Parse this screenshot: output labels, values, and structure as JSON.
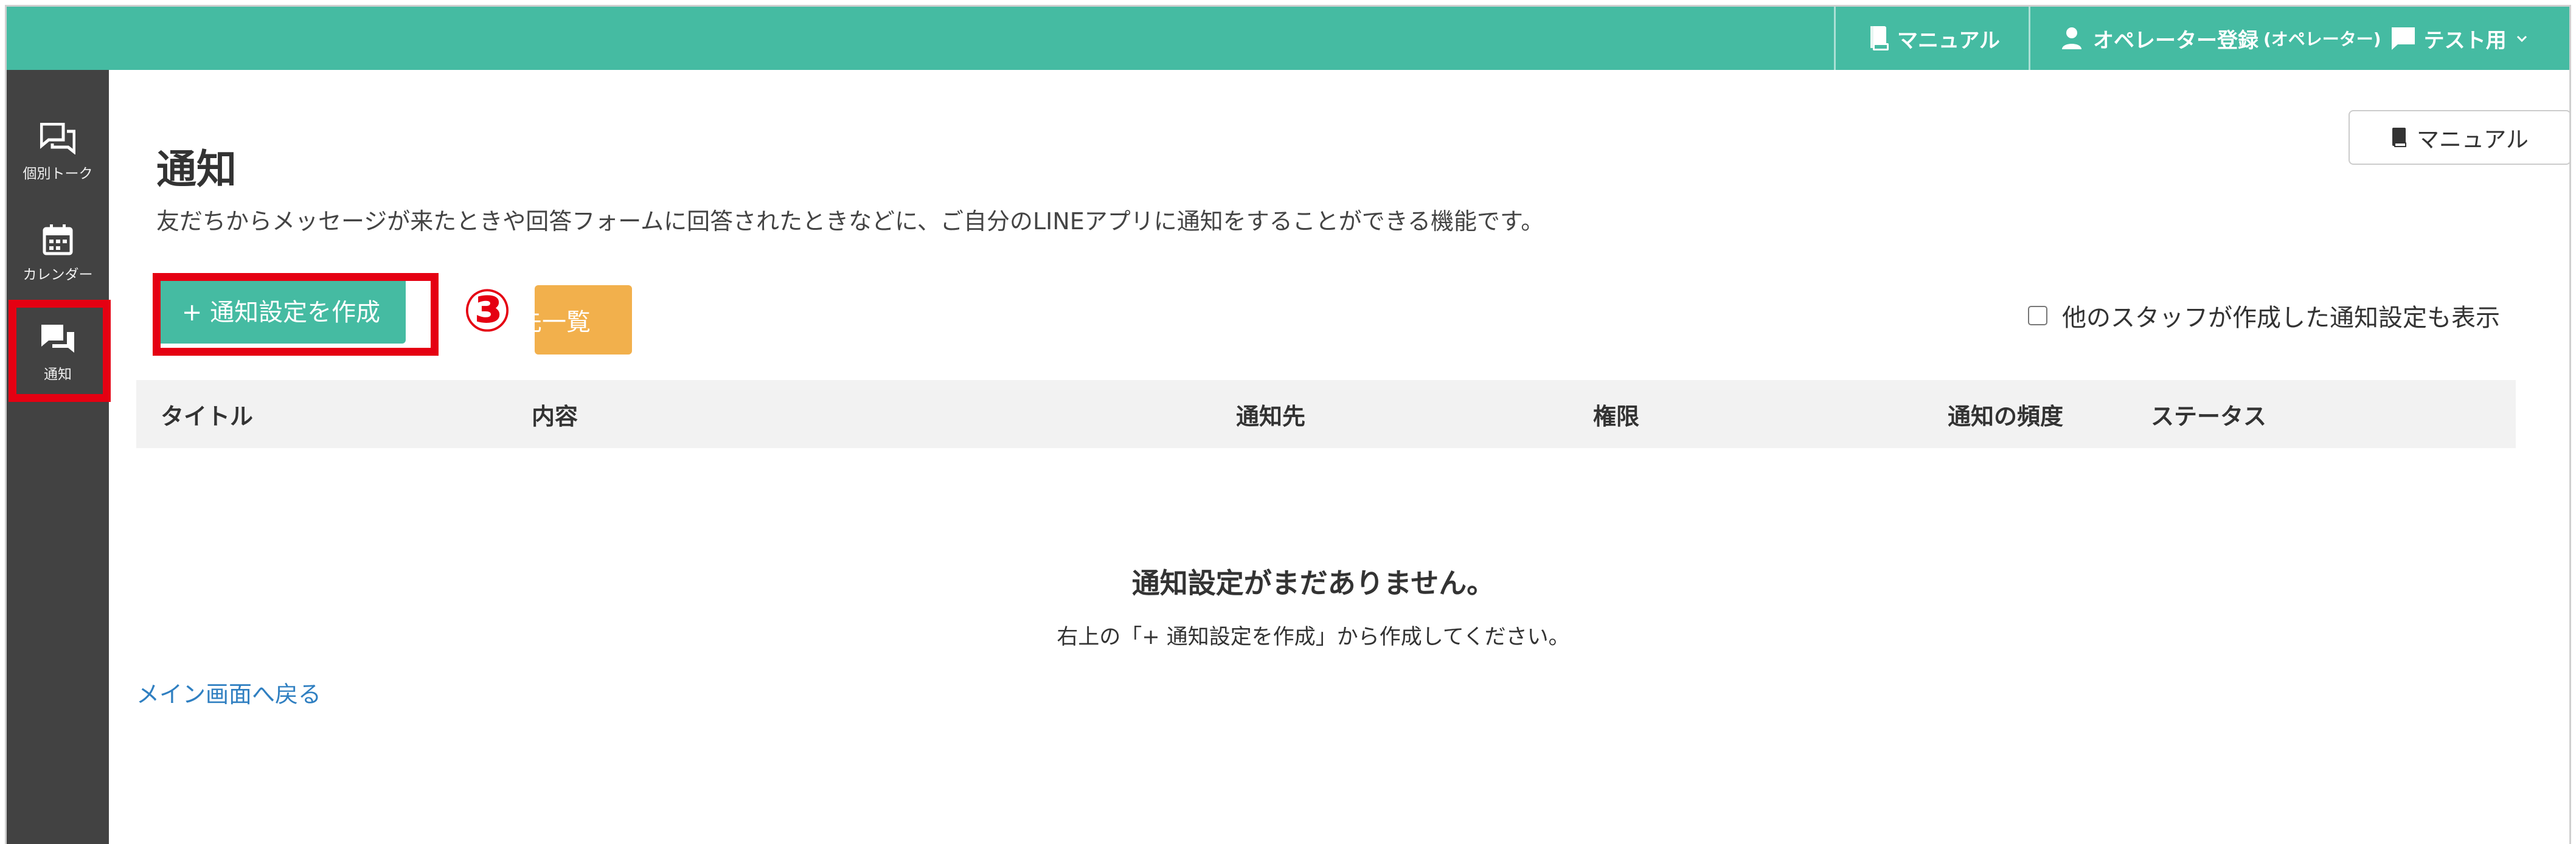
{
  "header": {
    "manual_label": "マニュアル",
    "user_label": "オペレーター登録",
    "user_role": "(オペレーター)",
    "account_label": "テスト用",
    "icons": [
      "book-icon",
      "person-icon",
      "chat-bubble-icon",
      "chevron-down-icon"
    ]
  },
  "sidebar": {
    "items": [
      {
        "label": "個別トーク",
        "icon": "chat-bubbles-icon"
      },
      {
        "label": "カレンダー",
        "icon": "calendar-icon"
      },
      {
        "label": "通知",
        "icon": "chat-bubbles-icon",
        "active": true
      }
    ]
  },
  "main": {
    "title": "通知",
    "description": "友だちからメッセージが来たときや回答フォームに回答されたときなどに、ご自分のLINEアプリに通知をすることができる機能です。",
    "manual_button": "マニュアル",
    "create_button": "+ 通知設定を作成",
    "step_marker": "③",
    "orange_button_partial": "先一覧",
    "show_others_label": "他のスタッフが作成した通知設定も表示",
    "table_headers": [
      "タイトル",
      "内容",
      "通知先",
      "権限",
      "通知の頻度",
      "ステータス"
    ],
    "empty_title": "通知設定がまだありません。",
    "empty_subtitle": "右上の「+ 通知設定を作成」から作成してください。",
    "back_link": "メイン画面へ戻る"
  },
  "colors": {
    "brand_green": "#45bba2",
    "sidebar_dark": "#424242",
    "highlight_red": "#e50012",
    "orange": "#f2b04c",
    "link_blue": "#2f7fc1"
  }
}
